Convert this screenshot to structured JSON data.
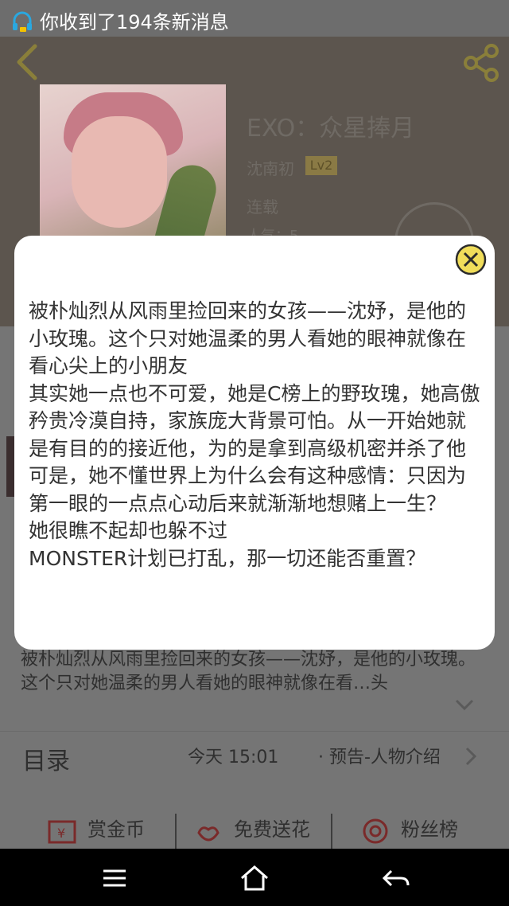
{
  "status_bar": {
    "notification_text": "你收到了194条新消息",
    "icon": "headset-icon"
  },
  "header": {
    "book_title": "EXO：众星捧月",
    "author": "沈南初",
    "level": "Lv2",
    "status": "连载",
    "popularity": "人气：5"
  },
  "synopsis": "被朴灿烈从风雨里捡回来的女孩——沈妤，是他的小玫瑰。这个只对她温柔的男人看她的眼神就像在看…头",
  "toc": {
    "label": "目录",
    "update_time": "今天 15:01",
    "latest_chapter": "· 预告-人物介绍"
  },
  "actions": {
    "reward": "赏金币",
    "flower": "免费送花",
    "fans": "粉丝榜"
  },
  "modal": {
    "content": "被朴灿烈从风雨里捡回来的女孩——沈妤，是他的小玫瑰。这个只对她温柔的男人看她的眼神就像在看心尖上的小朋友\n其实她一点也不可爱，她是C榜上的野玫瑰，她高傲矜贵冷漠自持，家族庞大背景可怕。从一开始她就是有目的的接近他，为的是拿到高级机密并杀了他\n可是，她不懂世界上为什么会有这种感情：只因为第一眼的一点点心动后来就渐渐地想赌上一生？\n她很瞧不起却也躲不过\nMONSTER计划已打乱，那一切还能否重置？"
  },
  "colors": {
    "accent": "#f0dd5a",
    "overlay": "#6e6e6e",
    "navbar": "#000000"
  }
}
